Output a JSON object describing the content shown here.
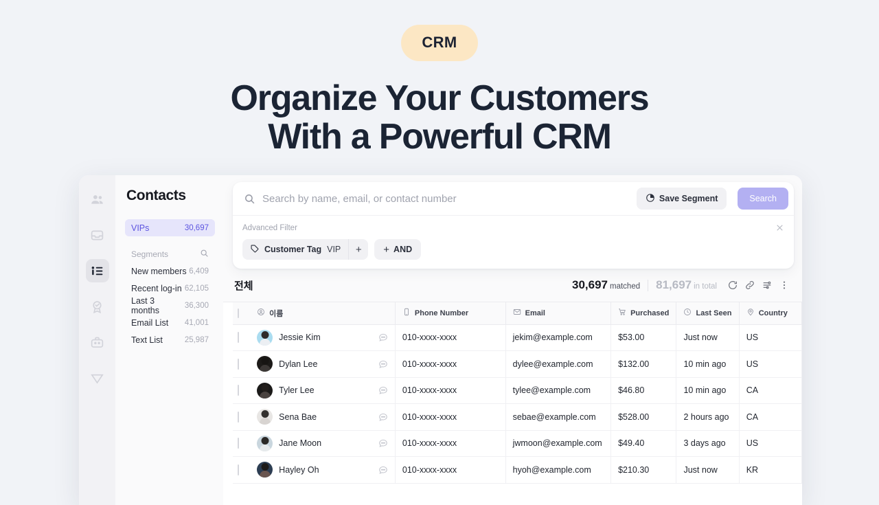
{
  "hero": {
    "badge": "CRM",
    "headline_line1": "Organize Your Customers",
    "headline_line2": "With a Powerful CRM"
  },
  "colors": {
    "page_bg": "#f1f3f7",
    "badge_bg": "#fce7c4",
    "headline": "#1b2434",
    "accent_lavender": "#b3b0f2",
    "vip_highlight_bg": "#e6e5fb",
    "vip_text": "#5c54e0"
  },
  "rail": {
    "items": [
      {
        "icon": "people-icon",
        "active": false
      },
      {
        "icon": "inbox-icon",
        "active": false
      },
      {
        "icon": "contact-list-icon",
        "active": true
      },
      {
        "icon": "badge-award-icon",
        "active": false
      },
      {
        "icon": "briefcase-icon",
        "active": false
      },
      {
        "icon": "send-icon",
        "active": false
      }
    ]
  },
  "sidebar": {
    "title": "Contacts",
    "vip": {
      "label": "VIPs",
      "count": "30,697"
    },
    "segments_label": "Segments",
    "segments_search_icon": "search-icon",
    "segments": [
      {
        "label": "New members",
        "count": "6,409"
      },
      {
        "label": "Recent log-in",
        "count": "62,105"
      },
      {
        "label": "Last 3 months",
        "count": "36,300"
      },
      {
        "label": "Email List",
        "count": "41,001"
      },
      {
        "label": "Text List",
        "count": "25,987"
      }
    ]
  },
  "search": {
    "placeholder": "Search by name, email, or contact number",
    "value": "",
    "save_segment_label": "Save Segment",
    "search_button_label": "Search"
  },
  "advanced_filter": {
    "label": "Advanced Filter",
    "chip": {
      "field": "Customer Tag",
      "value": "VIP",
      "plus": "+"
    },
    "and_button": {
      "plus": "+",
      "label": "AND"
    }
  },
  "results": {
    "title": "전체",
    "matched_count": "30,697",
    "matched_label": "matched",
    "total_count": "81,697",
    "total_label": "in total",
    "icons": [
      "refresh-icon",
      "link-icon",
      "sliders-icon",
      "more-vertical-icon"
    ]
  },
  "table": {
    "columns": [
      {
        "key": "check",
        "label": "",
        "icon": "checkbox-icon"
      },
      {
        "key": "name",
        "label": "이름",
        "icon": "person-circle-icon"
      },
      {
        "key": "phone",
        "label": "Phone Number",
        "icon": "phone-icon"
      },
      {
        "key": "email",
        "label": "Email",
        "icon": "envelope-icon"
      },
      {
        "key": "purchased",
        "label": "Purchased",
        "icon": "cart-icon"
      },
      {
        "key": "last_seen",
        "label": "Last Seen",
        "icon": "clock-icon"
      },
      {
        "key": "country",
        "label": "Country",
        "icon": "map-pin-icon"
      }
    ],
    "rows": [
      {
        "name": "Jessie Kim",
        "phone": "010-xxxx-xxxx",
        "email": "jekim@example.com",
        "purchased": "$53.00",
        "last_seen": "Just now",
        "country": "US",
        "avatar_bg": "#aadcf0",
        "avatar_hair": "#2e2b2a",
        "avatar_body": "#eceff3"
      },
      {
        "name": "Dylan Lee",
        "phone": "010-xxxx-xxxx",
        "email": "dylee@example.com",
        "purchased": "$132.00",
        "last_seen": "10 min ago",
        "country": "US",
        "avatar_bg": "#1c1a18",
        "avatar_hair": "#171513",
        "avatar_body": "#3c3836"
      },
      {
        "name": "Tyler Lee",
        "phone": "010-xxxx-xxxx",
        "email": "tylee@example.com",
        "purchased": "$46.80",
        "last_seen": "10 min ago",
        "country": "CA",
        "avatar_bg": "#1b1a19",
        "avatar_hair": "#231f1c",
        "avatar_body": "#4a4340"
      },
      {
        "name": "Sena Bae",
        "phone": "010-xxxx-xxxx",
        "email": "sebae@example.com",
        "purchased": "$528.00",
        "last_seen": "2 hours ago",
        "country": "CA",
        "avatar_bg": "#e8e6e4",
        "avatar_hair": "#33302e",
        "avatar_body": "#d8d4d1"
      },
      {
        "name": "Jane Moon",
        "phone": "010-xxxx-xxxx",
        "email": "jwmoon@example.com",
        "purchased": "$49.40",
        "last_seen": "3 days ago",
        "country": "US",
        "avatar_bg": "#c9d6de",
        "avatar_hair": "#2b2826",
        "avatar_body": "#e7eaec"
      },
      {
        "name": "Hayley Oh",
        "phone": "010-xxxx-xxxx",
        "email": "hyoh@example.com",
        "purchased": "$210.30",
        "last_seen": "Just now",
        "country": "KR",
        "avatar_bg": "#2c3d52",
        "avatar_hair": "#1d1a18",
        "avatar_body": "#6a5650"
      }
    ]
  }
}
